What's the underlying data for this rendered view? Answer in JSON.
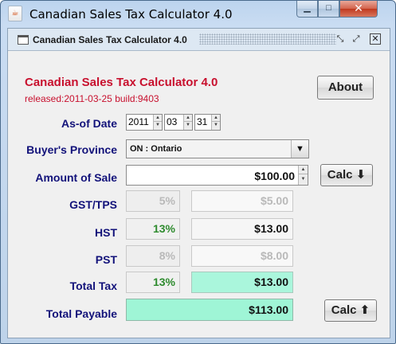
{
  "window": {
    "title": "Canadian Sales Tax Calculator 4.0",
    "icon_label": "☕",
    "minimize": "▁",
    "maximize": "□",
    "close": "✕"
  },
  "inner_frame": {
    "title": "Canadian Sales Tax Calculator 4.0",
    "restore": "⤡",
    "maximize": "⤢",
    "close": "✕"
  },
  "app": {
    "heading": "Canadian Sales Tax Calculator 4.0",
    "release": "released:2011-03-25 build:9403",
    "about_label": "About"
  },
  "form": {
    "as_of_date_label": "As-of Date",
    "date": {
      "year": "2011",
      "month": "03",
      "day": "31"
    },
    "buyers_province_label": "Buyer's Province",
    "province_value": "ON : Ontario",
    "amount_of_sale_label": "Amount of Sale",
    "amount_of_sale": "$100.00",
    "calc_down_label": "Calc ⬇",
    "calc_up_label": "Calc ⬆"
  },
  "taxes": {
    "gst": {
      "label": "GST/TPS",
      "rate": "5%",
      "amount": "$5.00"
    },
    "hst": {
      "label": "HST",
      "rate": "13%",
      "amount": "$13.00"
    },
    "pst": {
      "label": "PST",
      "rate": "8%",
      "amount": "$8.00"
    },
    "total_tax": {
      "label": "Total Tax",
      "rate": "13%",
      "amount": "$13.00"
    },
    "total_payable": {
      "label": "Total Payable",
      "amount": "$113.00"
    }
  },
  "colors": {
    "heading_red": "#c8102e",
    "label_navy": "#12127a",
    "rate_green": "#2e8b2e",
    "total_highlight": "#9ff5d6"
  }
}
